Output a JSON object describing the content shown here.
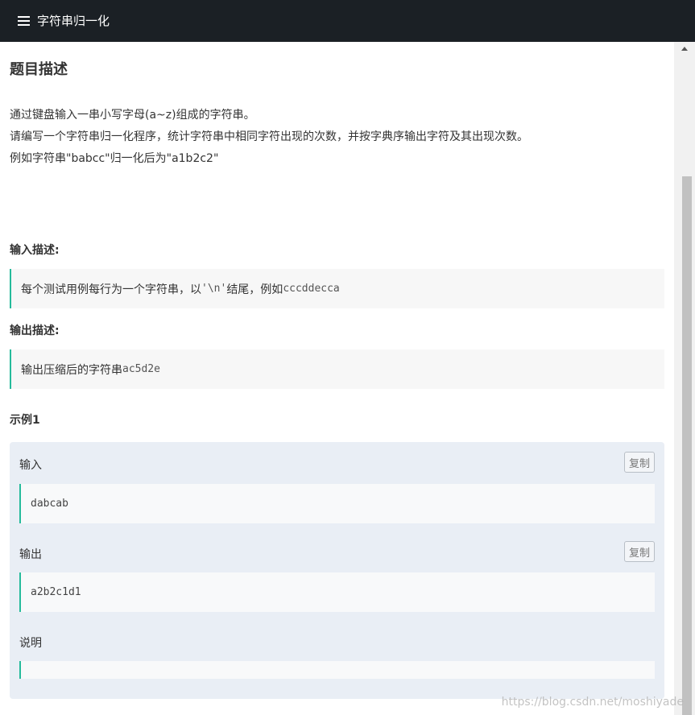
{
  "topbar": {
    "title": "字符串归一化",
    "icon": "list-icon"
  },
  "problem": {
    "section_title": "题目描述",
    "description_lines": [
      "通过键盘输入一串小写字母(a~z)组成的字符串。",
      "请编写一个字符串归一化程序，统计字符串中相同字符出现的次数，并按字典序输出字符及其出现次数。",
      "例如字符串\"babcc\"归一化后为\"a1b2c2\""
    ]
  },
  "input_desc": {
    "title": "输入描述:",
    "text_prefix": "每个测试用例每行为一个字符串，以",
    "code1": "'\\n'",
    "text_mid": "结尾，例如",
    "code2": "cccddecca"
  },
  "output_desc": {
    "title": "输出描述:",
    "text_prefix": "输出压缩后的字符串",
    "code": "ac5d2e"
  },
  "example": {
    "title": "示例1",
    "input_label": "输入",
    "input_value": "dabcab",
    "output_label": "输出",
    "output_value": "a2b2c1d1",
    "explain_label": "说明",
    "explain_value": "",
    "copy_label": "复制"
  },
  "watermark": "https://blog.csdn.net/moshiyade",
  "colors": {
    "topbar_bg": "#1b2025",
    "accent": "#25bb9b",
    "example_bg": "#e9eef5"
  }
}
